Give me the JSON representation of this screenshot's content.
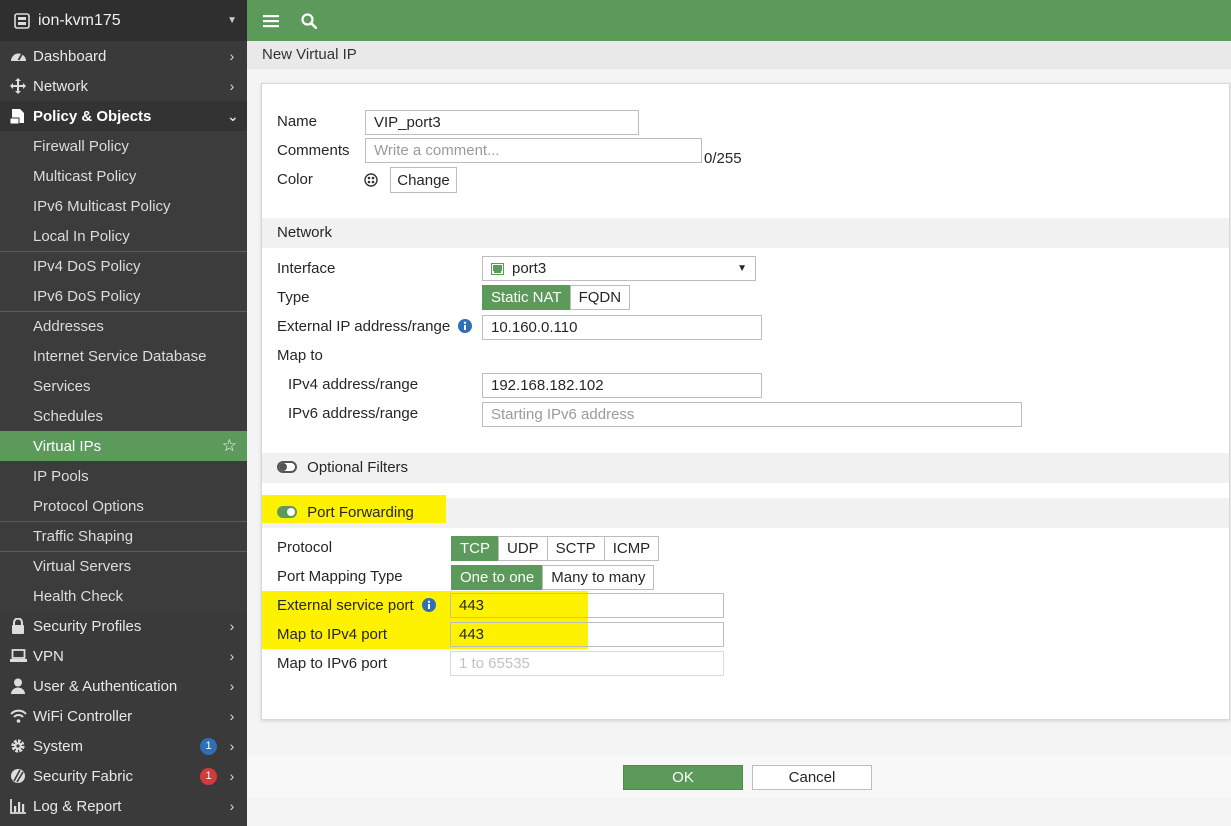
{
  "sidebar": {
    "device_name": "ion-kvm175",
    "top_items": [
      {
        "label": "Dashboard",
        "icon": "dashboard-icon"
      },
      {
        "label": "Network",
        "icon": "network-icon"
      }
    ],
    "policy": {
      "label": "Policy & Objects",
      "icon": "policy-icon",
      "sub_items": [
        "Firewall Policy",
        "Multicast Policy",
        "IPv6 Multicast Policy",
        "Local In Policy",
        "IPv4 DoS Policy",
        "IPv6 DoS Policy",
        "Addresses",
        "Internet Service Database",
        "Services",
        "Schedules",
        "Virtual IPs",
        "IP Pools",
        "Protocol Options",
        "Traffic Shaping",
        "Virtual Servers",
        "Health Check"
      ],
      "active_sub": "Virtual IPs"
    },
    "bottom_items": [
      {
        "label": "Security Profiles",
        "icon": "lock-icon"
      },
      {
        "label": "VPN",
        "icon": "laptop-icon"
      },
      {
        "label": "User & Authentication",
        "icon": "user-icon"
      },
      {
        "label": "WiFi Controller",
        "icon": "wifi-icon"
      },
      {
        "label": "System",
        "icon": "gear-icon",
        "badge": "1"
      },
      {
        "label": "Security Fabric",
        "icon": "fabric-icon",
        "badge": "1"
      },
      {
        "label": "Log & Report",
        "icon": "chart-icon"
      }
    ]
  },
  "page": {
    "title": "New Virtual IP"
  },
  "form": {
    "name_label": "Name",
    "name_value": "VIP_port3",
    "comments_label": "Comments",
    "comments_placeholder": "Write a comment...",
    "comments_counter": "0/255",
    "color_label": "Color",
    "change_label": "Change",
    "network_header": "Network",
    "interface_label": "Interface",
    "interface_value": "port3",
    "type_label": "Type",
    "type_options": [
      "Static NAT",
      "FQDN"
    ],
    "type_selected": "Static NAT",
    "ext_ip_label": "External IP address/range",
    "ext_ip_value": "10.160.0.110",
    "map_to_label": "Map to",
    "ipv4_range_label": "IPv4 address/range",
    "ipv4_range_value": "192.168.182.102",
    "ipv6_range_label": "IPv6 address/range",
    "ipv6_range_placeholder": "Starting IPv6 address",
    "optional_filters_label": "Optional Filters",
    "port_forwarding_label": "Port Forwarding",
    "protocol_label": "Protocol",
    "protocol_options": [
      "TCP",
      "UDP",
      "SCTP",
      "ICMP"
    ],
    "protocol_selected": "TCP",
    "mapping_type_label": "Port Mapping Type",
    "mapping_type_options": [
      "One to one",
      "Many to many"
    ],
    "mapping_type_selected": "One to one",
    "ext_port_label": "External service port",
    "ext_port_value": "443",
    "map_ipv4_port_label": "Map to IPv4 port",
    "map_ipv4_port_value": "443",
    "map_ipv6_port_label": "Map to IPv6 port",
    "map_ipv6_port_placeholder": "1 to 65535"
  },
  "footer": {
    "ok_label": "OK",
    "cancel_label": "Cancel"
  },
  "colors": {
    "accent_green": "#5b9a5a",
    "sidebar_bg": "#3a3a3a",
    "highlight": "#fff200",
    "badge_blue": "#2f6fb5",
    "badge_red": "#d23b3b"
  }
}
